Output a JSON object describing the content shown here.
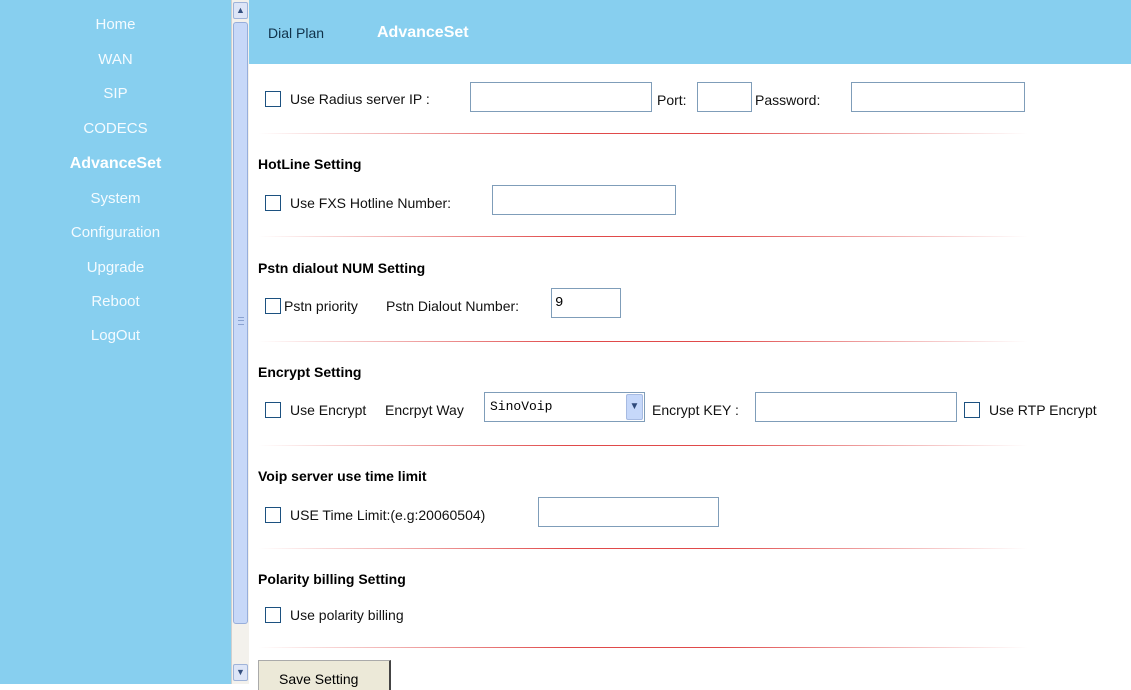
{
  "sidebar": {
    "items": [
      {
        "label": "Home"
      },
      {
        "label": "WAN"
      },
      {
        "label": "SIP"
      },
      {
        "label": "CODECS"
      },
      {
        "label": "AdvanceSet",
        "active": true
      },
      {
        "label": "System"
      },
      {
        "label": "Configuration"
      },
      {
        "label": "Upgrade"
      },
      {
        "label": "Reboot"
      },
      {
        "label": "LogOut"
      }
    ]
  },
  "header": {
    "tabs": [
      {
        "label": "Dial Plan"
      },
      {
        "label": "AdvanceSet",
        "active": true
      }
    ]
  },
  "radius": {
    "use_label": "Use  Radius server IP :",
    "port_label": "Port:",
    "password_label": "Password:",
    "ip_value": "",
    "port_value": "",
    "password_value": ""
  },
  "hotline": {
    "title": "HotLine Setting",
    "use_label": "Use FXS Hotline Number:",
    "number_value": ""
  },
  "pstn": {
    "title": "Pstn dialout NUM Setting",
    "priority_label": "Pstn priority",
    "number_label": "Pstn Dialout Number:",
    "number_value": "9"
  },
  "encrypt": {
    "title": "Encrypt Setting",
    "use_label": "Use Encrypt",
    "way_label": "Encrpyt Way",
    "way_value": "SinoVoip",
    "key_label": "Encrypt KEY :",
    "key_value": "",
    "rtp_label": "Use RTP Encrypt"
  },
  "timelimit": {
    "title": "Voip server use time limit",
    "use_label": "USE Time Limit:(e.g:20060504)",
    "value": ""
  },
  "polarity": {
    "title": "Polarity billing Setting",
    "use_label": "Use polarity billing"
  },
  "actions": {
    "save_label": "Save Setting"
  },
  "colors": {
    "sidebar_bg": "#87cfef",
    "divider": "#e04a4a"
  },
  "icons": {
    "scroll_up": "scroll-up-arrow-icon",
    "scroll_down": "scroll-down-arrow-icon",
    "dropdown": "chevron-down-icon"
  }
}
